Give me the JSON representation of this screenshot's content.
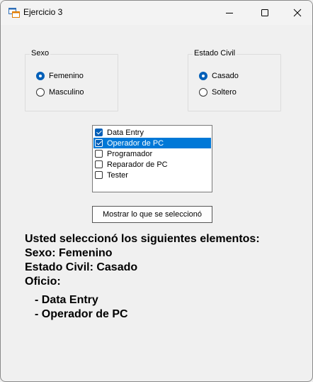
{
  "window": {
    "title": "Ejercicio 3"
  },
  "sexo": {
    "label": "Sexo",
    "options": [
      {
        "label": "Femenino",
        "checked": true
      },
      {
        "label": "Masculino",
        "checked": false
      }
    ]
  },
  "estado_civil": {
    "label": "Estado Civil",
    "options": [
      {
        "label": "Casado",
        "checked": true
      },
      {
        "label": "Soltero",
        "checked": false
      }
    ]
  },
  "oficios": [
    {
      "label": "Data Entry",
      "checked": true,
      "selected": false
    },
    {
      "label": "Operador de PC",
      "checked": true,
      "selected": true
    },
    {
      "label": "Programador",
      "checked": false,
      "selected": false
    },
    {
      "label": "Reparador de PC",
      "checked": false,
      "selected": false
    },
    {
      "label": "Tester",
      "checked": false,
      "selected": false
    }
  ],
  "button": {
    "label": "Mostrar lo que se seleccionó"
  },
  "result": {
    "heading": "Usted seleccionó los siguientes elementos:",
    "sexo": "Sexo: Femenino",
    "estado_civil": "Estado Civil: Casado",
    "oficio": "Oficio:",
    "items": [
      "- Data Entry",
      "- Operador de PC"
    ]
  },
  "colors": {
    "accent": "#005fb8",
    "selection": "#0078d7",
    "background": "#f0f0f0"
  }
}
